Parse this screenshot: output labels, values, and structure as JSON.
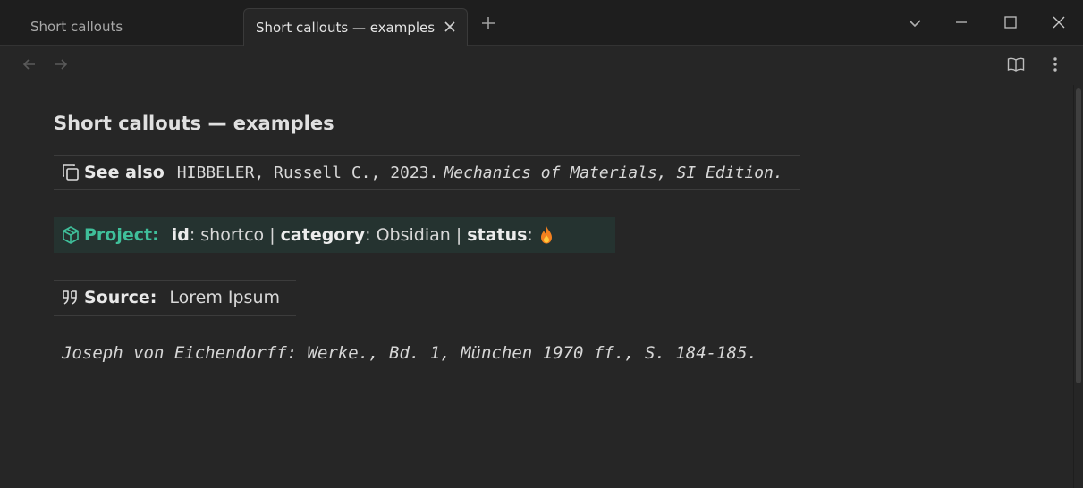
{
  "tabs": [
    {
      "label": "Short callouts",
      "active": false
    },
    {
      "label": "Short callouts — examples",
      "active": true
    }
  ],
  "icons": {
    "new_tab": "plus-icon",
    "tab_list": "chevron-down-icon",
    "minimize": "minimize-icon",
    "maximize": "maximize-icon",
    "close": "close-icon",
    "back": "arrow-left-icon",
    "forward": "arrow-right-icon",
    "reading_view": "book-open-icon",
    "more": "more-vertical-icon"
  },
  "note": {
    "title": "Short callouts — examples",
    "see_also": {
      "label": "See also",
      "text_plain": "HIBBELER, Russell C., 2023.",
      "text_italic": "Mechanics of Materials, SI Edition",
      "text_end": "."
    },
    "project": {
      "label": "Project:",
      "id_key": "id",
      "id_value": ": shortco |",
      "category_key": "category",
      "category_value": ": Obsidian |",
      "status_key": "status",
      "status_sep": ":",
      "status_icon": "🔥"
    },
    "source": {
      "label": "Source:",
      "text": "Lorem Ipsum"
    },
    "quote": "Joseph von Eichendorff: Werke., Bd. 1, München 1970 ff., S. 184-185."
  },
  "colors": {
    "accent_green": "#3fbf9a",
    "project_bg": "#253330",
    "background": "#262626"
  }
}
